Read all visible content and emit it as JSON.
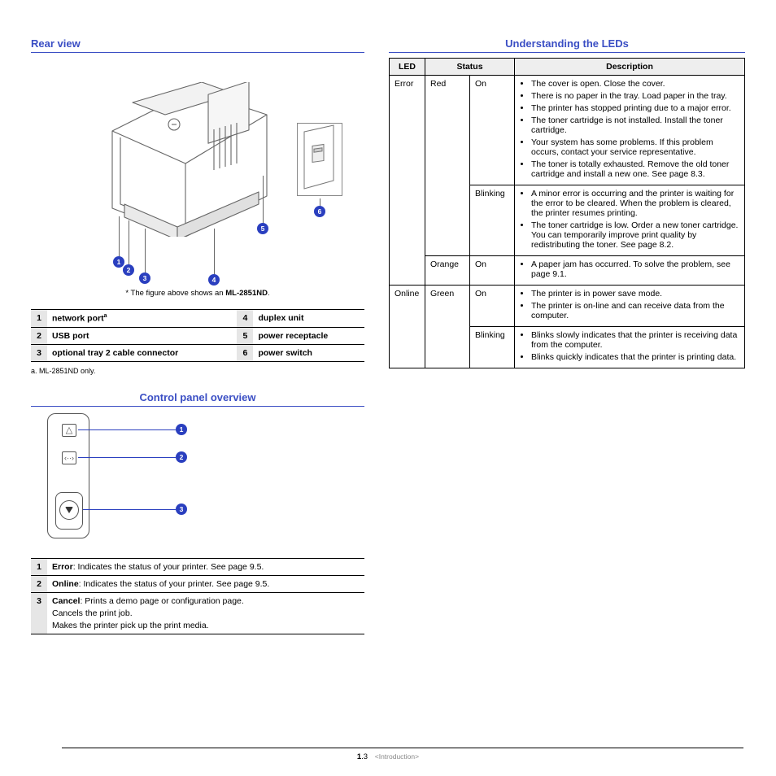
{
  "left": {
    "heading_rear": "Rear view",
    "caption_pre": "* The figure above shows an ",
    "caption_model": "ML-2851ND",
    "caption_post": ".",
    "parts": [
      {
        "n": "1",
        "label": "network port",
        "sup": "a"
      },
      {
        "n": "2",
        "label": "USB port",
        "sup": ""
      },
      {
        "n": "3",
        "label": "optional tray 2 cable connector",
        "sup": ""
      },
      {
        "n": "4",
        "label": "duplex unit",
        "sup": ""
      },
      {
        "n": "5",
        "label": "power receptacle",
        "sup": ""
      },
      {
        "n": "6",
        "label": "power switch",
        "sup": ""
      }
    ],
    "footnote": "a. ML-2851ND only.",
    "heading_cp": "Control panel overview",
    "cp_rows": [
      {
        "n": "1",
        "bold": "Error",
        "rest": ": Indicates the status of your printer. See page 9.5."
      },
      {
        "n": "2",
        "bold": "Online",
        "rest": ": Indicates the status of your printer. See page 9.5."
      },
      {
        "n": "3",
        "bold": "Cancel",
        "rest": ": Prints a demo page or configuration page.",
        "extra": [
          "Cancels the print job.",
          "Makes the printer pick up the print media."
        ]
      }
    ],
    "callouts": [
      "1",
      "2",
      "3",
      "4",
      "5",
      "6"
    ],
    "cp_callouts": [
      "1",
      "2",
      "3"
    ]
  },
  "right": {
    "heading": "Understanding the LEDs",
    "th": {
      "led": "LED",
      "status": "Status",
      "desc": "Description"
    },
    "rows": [
      {
        "led": "Error",
        "color": "Red",
        "mode": "On",
        "bullets": [
          "The cover is open. Close the cover.",
          "There is no paper in the tray. Load paper in the tray.",
          "The printer has stopped printing due to a major error.",
          "The toner cartridge is not installed. Install the toner cartridge.",
          "Your system has some problems. If this problem occurs, contact your service representative.",
          "The toner is totally exhausted. Remove the old toner cartridge and install a new one. See page 8.3."
        ]
      },
      {
        "led": "",
        "color": "",
        "mode": "Blinking",
        "bullets": [
          "A minor error is occurring and the printer is waiting for the error to be cleared. When the problem is cleared, the printer resumes printing.",
          "The toner cartridge is low. Order a new toner cartridge. You can temporarily improve print quality by redistributing the toner. See page 8.2."
        ]
      },
      {
        "led": "",
        "color": "Orange",
        "mode": "On",
        "bullets": [
          "A paper jam has occurred. To solve the problem, see page 9.1."
        ]
      },
      {
        "led": "Online",
        "color": "Green",
        "mode": "On",
        "bullets": [
          "The printer is in power save mode.",
          "The printer is on-line and can receive data from the computer."
        ]
      },
      {
        "led": "",
        "color": "",
        "mode": "Blinking",
        "bullets": [
          "Blinks slowly indicates that the printer is receiving data from the computer.",
          "Blinks quickly indicates that the printer is printing data."
        ]
      }
    ]
  },
  "footer": {
    "page_bold": "1",
    "page_rest": ".3",
    "chapter": "<Introduction>"
  }
}
